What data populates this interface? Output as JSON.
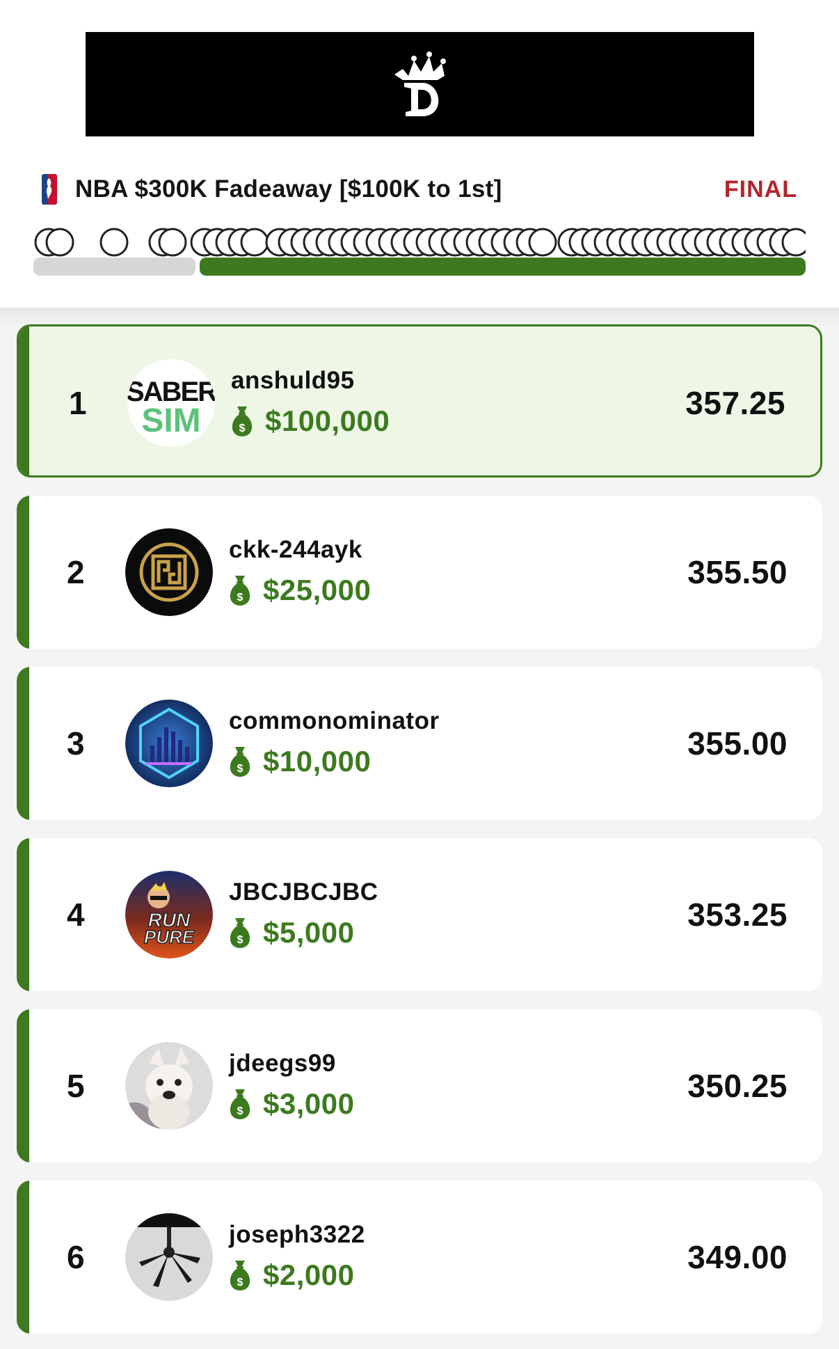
{
  "header": {
    "brand": "DraftKings",
    "contest_title": "NBA $300K Fadeaway [$100K to 1st]",
    "league": "NBA",
    "status": "FINAL",
    "progress": 0.79
  },
  "colors": {
    "accent_green": "#3d7a1f",
    "final_red": "#b3262c",
    "top_card_bg": "#eef7e6"
  },
  "icons": {
    "prize": "money-bag-icon"
  },
  "leaderboard": [
    {
      "rank": "1",
      "username": "anshuld95",
      "prize": "$100,000",
      "score": "357.25"
    },
    {
      "rank": "2",
      "username": "ckk-244ayk",
      "prize": "$25,000",
      "score": "355.50"
    },
    {
      "rank": "3",
      "username": "commonominator",
      "prize": "$10,000",
      "score": "355.00"
    },
    {
      "rank": "4",
      "username": "JBCJBCJBC",
      "prize": "$5,000",
      "score": "353.25"
    },
    {
      "rank": "5",
      "username": "jdeegs99",
      "prize": "$3,000",
      "score": "350.25"
    },
    {
      "rank": "6",
      "username": "joseph3322",
      "prize": "$2,000",
      "score": "349.00"
    }
  ],
  "avatars": {
    "saber_line1": "SABER",
    "saber_line2": "SIM",
    "run_line1": "RUN",
    "run_line2": "PURE"
  }
}
